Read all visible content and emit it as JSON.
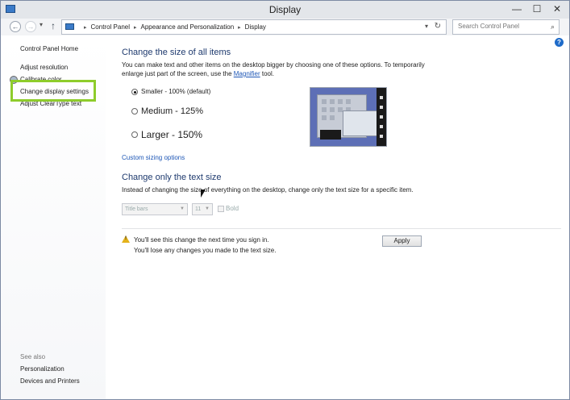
{
  "window": {
    "title": "Display"
  },
  "window_controls": {
    "minimize": "—",
    "maximize": "☐",
    "close": "✕"
  },
  "nav": {
    "back": "←",
    "forward": "→",
    "up": "↑"
  },
  "address": {
    "crumbs": [
      "Control Panel",
      "Appearance and Personalization",
      "Display"
    ],
    "separator": "▸",
    "dropdown": "▾",
    "refresh": "↻"
  },
  "search": {
    "placeholder": "Search Control Panel",
    "icon": "⌕"
  },
  "help": "?",
  "sidebar": {
    "home": "Control Panel Home",
    "items": [
      "Adjust resolution",
      "Calibrate color",
      "Change display settings",
      "Adjust ClearType text"
    ],
    "see_also_label": "See also",
    "see_also": [
      "Personalization",
      "Devices and Printers"
    ]
  },
  "section1": {
    "title": "Change the size of all items",
    "desc1": "You can make text and other items on the desktop bigger by choosing one of these options. To temporarily",
    "desc2_prefix": "enlarge just part of the screen, use the ",
    "desc2_link": "Magnifier",
    "desc2_suffix": " tool.",
    "options": [
      {
        "label": "Smaller - 100% (default)",
        "selected": true
      },
      {
        "label": "Medium - 125%",
        "selected": false
      },
      {
        "label": "Larger - 150%",
        "selected": false
      }
    ],
    "custom_link": "Custom sizing options"
  },
  "section2": {
    "title": "Change only the text size",
    "desc": "Instead of changing the size of everything on the desktop, change only the text size for a specific item.",
    "item_select": "Title bars",
    "size_select": "11",
    "bold_label": "Bold"
  },
  "notice": {
    "line1": "You'll see this change the next time you sign in.",
    "line2": "You'll lose any changes you made to the text size."
  },
  "apply_label": "Apply"
}
